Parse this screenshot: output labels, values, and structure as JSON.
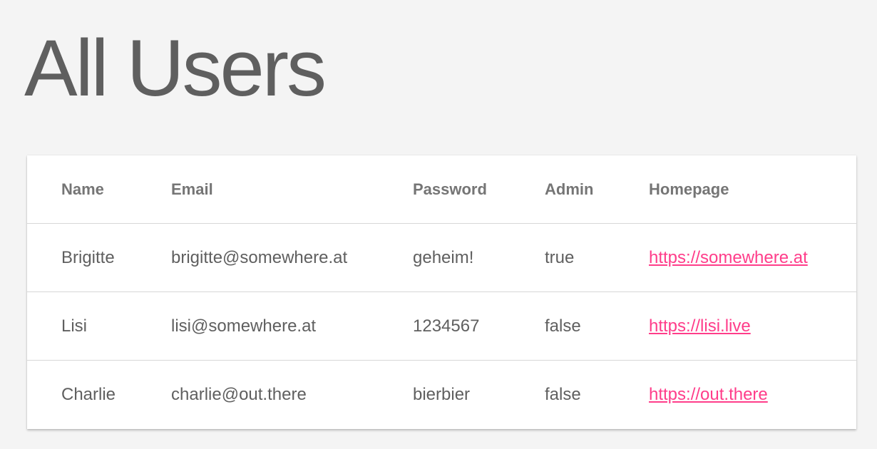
{
  "page": {
    "title": "All Users"
  },
  "table": {
    "headers": {
      "name": "Name",
      "email": "Email",
      "password": "Password",
      "admin": "Admin",
      "homepage": "Homepage"
    },
    "rows": [
      {
        "name": "Brigitte",
        "email": "brigitte@somewhere.at",
        "password": "geheim!",
        "admin": "true",
        "homepage": "https://somewhere.at"
      },
      {
        "name": "Lisi",
        "email": "lisi@somewhere.at",
        "password": "1234567",
        "admin": "false",
        "homepage": "https://lisi.live"
      },
      {
        "name": "Charlie",
        "email": "charlie@out.there",
        "password": "bierbier",
        "admin": "false",
        "homepage": "https://out.there"
      }
    ]
  },
  "colors": {
    "background": "#f4f4f4",
    "card": "#ffffff",
    "text": "#5f5f5f",
    "header_text": "#757575",
    "link": "#ff3d8a",
    "divider": "#d7d7d7"
  }
}
